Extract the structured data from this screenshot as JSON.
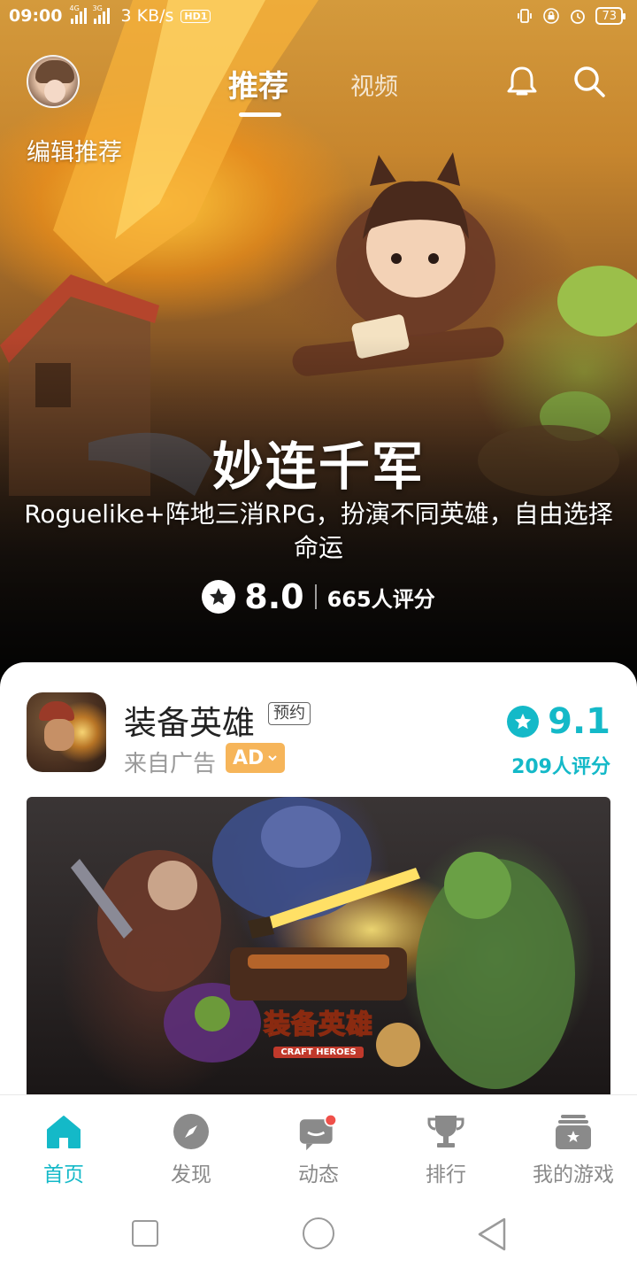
{
  "status_bar": {
    "time": "09:00",
    "network_speed": "3 KB/s",
    "hd_label": "HD1",
    "battery": "73",
    "signal_tags": [
      "4G",
      "3G"
    ]
  },
  "top_nav": {
    "edit_label": "编辑推荐",
    "tabs": [
      {
        "label": "推荐",
        "active": true
      },
      {
        "label": "视频",
        "active": false
      }
    ]
  },
  "hero": {
    "title": "妙连千军",
    "description": "Roguelike+阵地三消RPG，扮演不同英雄，自由选择命运",
    "score": "8.0",
    "review_count": "665人评分"
  },
  "ad_card": {
    "app_name": "装备英雄",
    "tag": "预约",
    "source": "来自广告",
    "ad_badge": "AD",
    "score": "9.1",
    "review_count": "209人评分",
    "banner_logo_cn": "装备英雄",
    "banner_logo_en": "CRAFT HEROES"
  },
  "bottom_nav": {
    "items": [
      {
        "label": "首页",
        "icon": "home-icon",
        "active": true
      },
      {
        "label": "发现",
        "icon": "compass-icon",
        "active": false
      },
      {
        "label": "动态",
        "icon": "chat-icon",
        "active": false
      },
      {
        "label": "排行",
        "icon": "trophy-icon",
        "active": false
      },
      {
        "label": "我的游戏",
        "icon": "game-library-icon",
        "active": false
      }
    ]
  },
  "colors": {
    "accent": "#14b9c8",
    "ad_badge": "#f6b55a",
    "notification_dot": "#f0504a",
    "inactive_nav": "#8a8a8a"
  }
}
